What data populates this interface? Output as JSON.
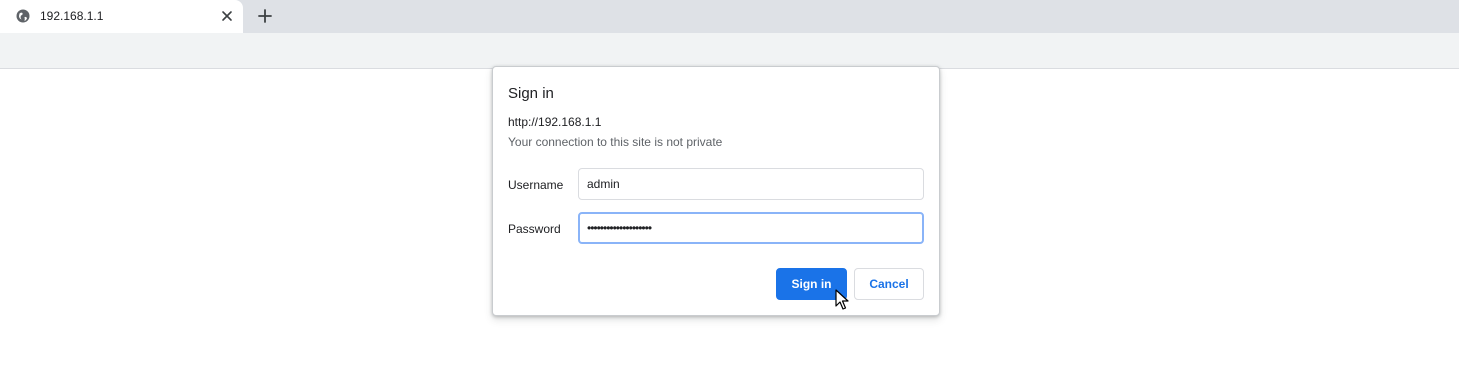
{
  "tab": {
    "title": "192.168.1.1",
    "favicon": "globe-icon"
  },
  "icons": {
    "tab_close": "close-icon",
    "new_tab": "plus-icon",
    "cursor": "mouse-pointer-icon"
  },
  "dialog": {
    "title": "Sign in",
    "url": "http://192.168.1.1",
    "warning": "Your connection to this site is not private",
    "username_label": "Username",
    "username_value": "admin",
    "password_label": "Password",
    "password_masked": "••••••••••••••••••••",
    "signin_label": "Sign in",
    "cancel_label": "Cancel"
  },
  "colors": {
    "accent": "#1a73e8",
    "focus_ring": "#8ab4f8",
    "tabstrip": "#dee1e6",
    "toolbar": "#f1f3f4"
  }
}
